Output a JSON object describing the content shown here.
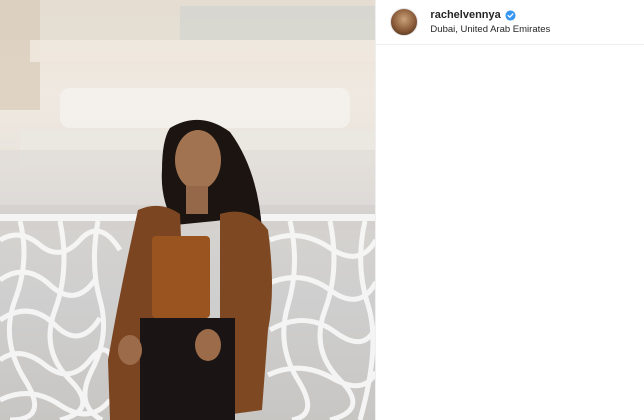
{
  "post": {
    "username": "rachelvennya",
    "location": "Dubai, United Arab Emirates",
    "verified": true,
    "photo_alt": "woman in brown blazer standing at a white decorative railing",
    "colors": {
      "verified_blue": "#3897f0",
      "text": "#262626",
      "border": "#efefef"
    },
    "icons": [
      "verified-badge-icon"
    ]
  }
}
